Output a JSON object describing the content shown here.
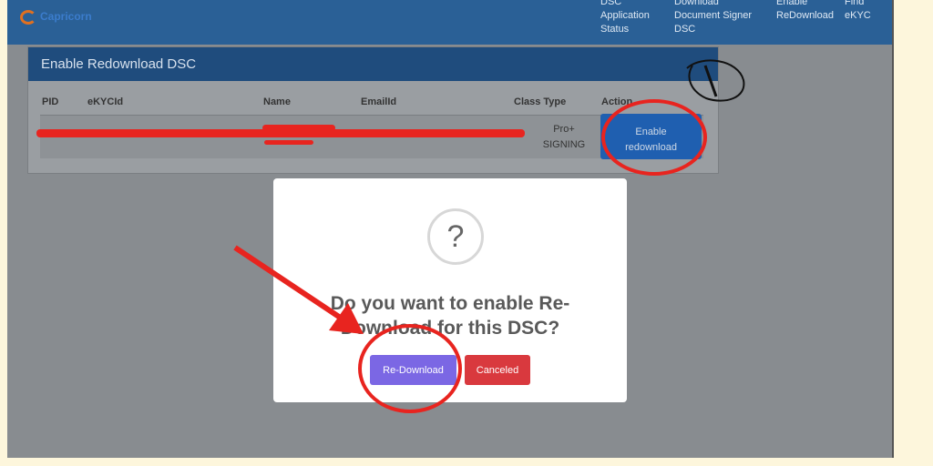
{
  "nav": {
    "logo_text": "Capricorn",
    "items": [
      {
        "line1": "DSC",
        "line2": "Application",
        "line3": "Status"
      },
      {
        "line1": "Download",
        "line2": "Document Signer",
        "line3": "DSC"
      },
      {
        "line1": "Enable",
        "line2": "ReDownload",
        "line3": ""
      },
      {
        "line1": "Find",
        "line2": "eKYC",
        "line3": ""
      }
    ]
  },
  "panel": {
    "title": "Enable Redownload DSC",
    "columns": [
      "PID",
      "eKYCId",
      "Name",
      "EmailId",
      "Class Type",
      "Action"
    ],
    "row": {
      "class_line1": "Pro+",
      "class_line2": "SIGNING",
      "action_line1": "Enable",
      "action_line2": "redownload"
    }
  },
  "modal": {
    "icon": "question-icon",
    "icon_glyph": "?",
    "title_line1": "Do you want to enable Re-",
    "title_line2": "Download for this DSC?",
    "confirm_label": "Re-Download",
    "cancel_label": "Canceled"
  },
  "annotations": {
    "step_number": "1",
    "color": "#e8241f"
  }
}
